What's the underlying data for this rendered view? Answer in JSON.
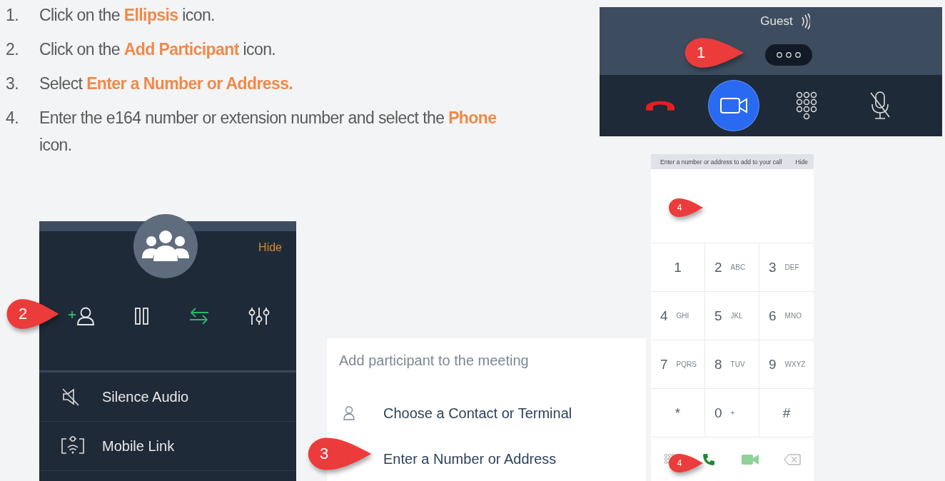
{
  "steps": [
    {
      "number": "1.",
      "text": "Click on the **Ellipsis** icon."
    },
    {
      "number": "2.",
      "text": "Click on the **Add Participant** icon."
    },
    {
      "number": "3.",
      "text": "Select **Enter a Number or Address.**"
    },
    {
      "number": "4.",
      "text": "Enter the e164 number or extension number and select the **Phone** icon."
    }
  ],
  "call_bar": {
    "caller": "Guest",
    "callout": "1",
    "controls": [
      {
        "kind": "hangup",
        "on": false
      },
      {
        "kind": "video",
        "on": true
      },
      {
        "kind": "dialpad",
        "on": false
      },
      {
        "kind": "mic-muted",
        "on": false
      }
    ]
  },
  "participants_menu": {
    "hide": "Hide",
    "callout": "2",
    "actions": [
      {
        "kind": "add-participant",
        "highlighted": false
      },
      {
        "kind": "hold",
        "highlighted": false
      },
      {
        "kind": "transfer",
        "highlighted": true
      },
      {
        "kind": "equalizer",
        "highlighted": false
      }
    ],
    "items": [
      {
        "kind": "silence",
        "label": "Silence Audio"
      },
      {
        "kind": "mobile-link",
        "label": "Mobile Link"
      }
    ]
  },
  "add_participant": {
    "title": "Add participant to the meeting",
    "callout": "3",
    "options": [
      {
        "kind": "contact",
        "label": "Choose a Contact or Terminal"
      },
      {
        "kind": "number",
        "label": "Enter a Number or Address"
      }
    ]
  },
  "dialpad": {
    "header": "Enter a number or address to add to your call",
    "hide": "Hide",
    "input_callout": "4",
    "call_callout": "4",
    "keys": [
      {
        "digit": "1"
      },
      {
        "digit": "2",
        "letters": "ABC"
      },
      {
        "digit": "3",
        "letters": "DEF"
      },
      {
        "digit": "4",
        "letters": "GHI"
      },
      {
        "digit": "5",
        "letters": "JKL"
      },
      {
        "digit": "6",
        "letters": "MNO"
      },
      {
        "digit": "7",
        "letters": "PQRS"
      },
      {
        "digit": "8",
        "letters": "TUV"
      },
      {
        "digit": "9",
        "letters": "WXYZ"
      },
      {
        "digit": "*"
      },
      {
        "digit": "0",
        "letters": "+"
      },
      {
        "digit": "#"
      }
    ],
    "bottom": [
      {
        "kind": "dialpad"
      },
      {
        "kind": "call"
      },
      {
        "kind": "video"
      },
      {
        "kind": "backspace"
      }
    ]
  }
}
